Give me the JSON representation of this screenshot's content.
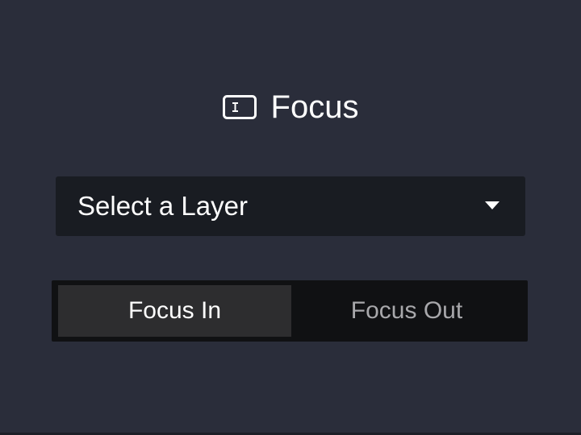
{
  "panel": {
    "title": "Focus",
    "title_icon": "text-cursor-box-icon",
    "layer_select": {
      "value": "Select a Layer",
      "caret_icon": "caret-down-icon"
    },
    "focus_mode": {
      "options": [
        "Focus In",
        "Focus Out"
      ],
      "selected": "Focus In"
    }
  },
  "colors": {
    "background": "#2a2d3a",
    "select_background": "#191c22",
    "toggle_background": "#101113",
    "active_option": "#2d2d2f",
    "text_primary": "#ffffff",
    "text_muted": "#a8a8ab"
  }
}
